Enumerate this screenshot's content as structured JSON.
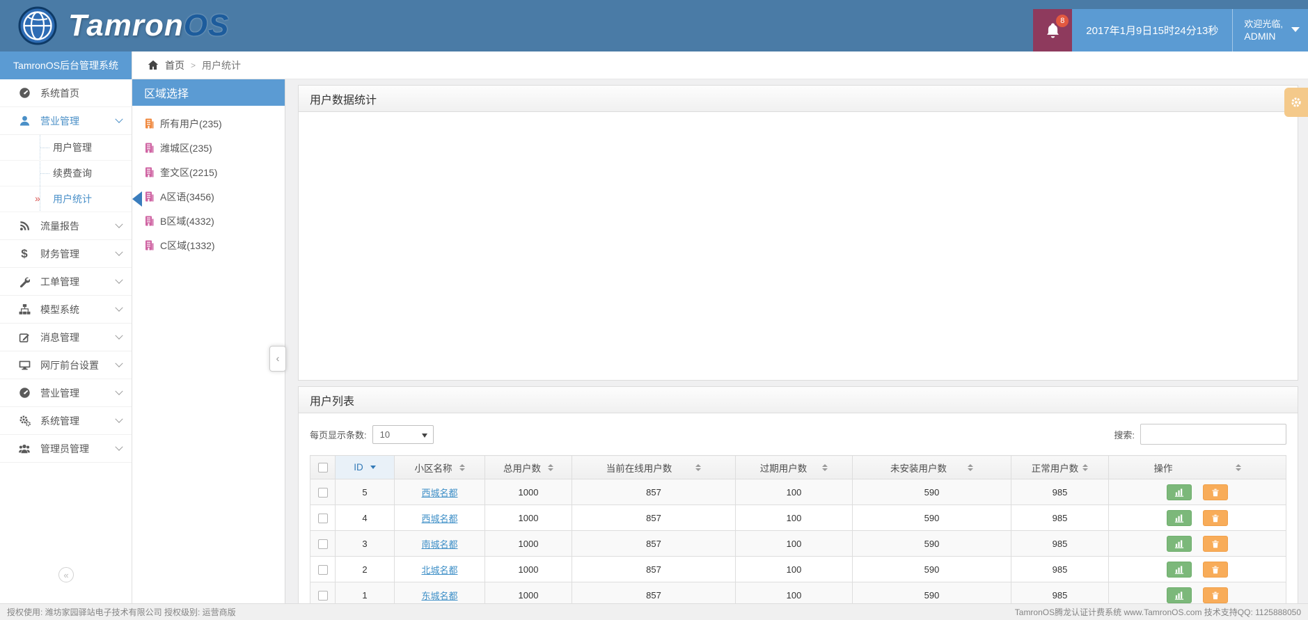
{
  "colors": {
    "topbar": "#4a7ba6",
    "panel_blue": "#5b9bd3",
    "logo_os_blue": "#1d5c9c",
    "notification_bg": "#8e3a5d",
    "badge_red": "#e25840",
    "active_blue": "#4a90c9",
    "link_blue": "#3e8fc7",
    "sorted_header_blue": "#337ab7",
    "button_green": "#7cb87a",
    "button_orange": "#f8ac59",
    "gear_tab_orange": "#f4c98a",
    "region_icon_orange": "#f0883e",
    "region_icon_pink": "#cf63a2",
    "active_sub_mark_red": "#d9534f"
  },
  "icons": {
    "dollar": "$",
    "active_sub": "»",
    "collapse_left": "«",
    "panel_collapse": "‹",
    "breadcrumb_sep": ">"
  },
  "topbar": {
    "brand_1": "Tamron",
    "brand_2": "OS",
    "notification_count": "8",
    "datetime": "2017年1月9日15时24分13秒",
    "welcome": "欢迎光临,",
    "username": "ADMIN"
  },
  "sidebar": {
    "title": "TamronOS后台管理系统",
    "items": [
      {
        "label": "系统首页"
      },
      {
        "label": "营业管理"
      },
      {
        "label": "流量报告"
      },
      {
        "label": "财务管理"
      },
      {
        "label": "工单管理"
      },
      {
        "label": "模型系统"
      },
      {
        "label": "消息管理"
      },
      {
        "label": "网厅前台设置"
      },
      {
        "label": "营业管理"
      },
      {
        "label": "系统管理"
      },
      {
        "label": "管理员管理"
      }
    ],
    "submenu": [
      {
        "label": "用户管理"
      },
      {
        "label": "续费查询"
      },
      {
        "label": "用户统计"
      }
    ]
  },
  "breadcrumb": {
    "home": "首页",
    "current": "用户统计"
  },
  "region_panel": {
    "title": "区域选择",
    "items": [
      {
        "label": "所有用户(235)"
      },
      {
        "label": "潍城区(235)"
      },
      {
        "label": "奎文区(2215)"
      },
      {
        "label": "A区语(3456)"
      },
      {
        "label": "B区域(4332)"
      },
      {
        "label": "C区域(1332)"
      }
    ]
  },
  "stats_panel": {
    "title": "用户数据统计"
  },
  "list_panel": {
    "title": "用户列表",
    "per_page_label": "每页显示条数:",
    "per_page_value": "10",
    "search_label": "搜索:",
    "columns": [
      "ID",
      "小区名称",
      "总用户数",
      "当前在线用户数",
      "过期用户数",
      "未安装用户数",
      "正常用户数",
      "操作"
    ],
    "rows": [
      {
        "id": "5",
        "name": "西城名都",
        "total": "1000",
        "online": "857",
        "expired": "100",
        "uninstalled": "590",
        "normal": "985"
      },
      {
        "id": "4",
        "name": "西城名都",
        "total": "1000",
        "online": "857",
        "expired": "100",
        "uninstalled": "590",
        "normal": "985"
      },
      {
        "id": "3",
        "name": "南城名都",
        "total": "1000",
        "online": "857",
        "expired": "100",
        "uninstalled": "590",
        "normal": "985"
      },
      {
        "id": "2",
        "name": "北城名都",
        "total": "1000",
        "online": "857",
        "expired": "100",
        "uninstalled": "590",
        "normal": "985"
      },
      {
        "id": "1",
        "name": "东城名都",
        "total": "1000",
        "online": "857",
        "expired": "100",
        "uninstalled": "590",
        "normal": "985"
      }
    ]
  },
  "footer": {
    "left": "授权使用: 潍坊家园驿站电子技术有限公司  授权级别: 运营商版",
    "right": "TamronOS腾龙认证计费系统 www.TamronOS.com 技术支持QQ: 1125888050"
  }
}
